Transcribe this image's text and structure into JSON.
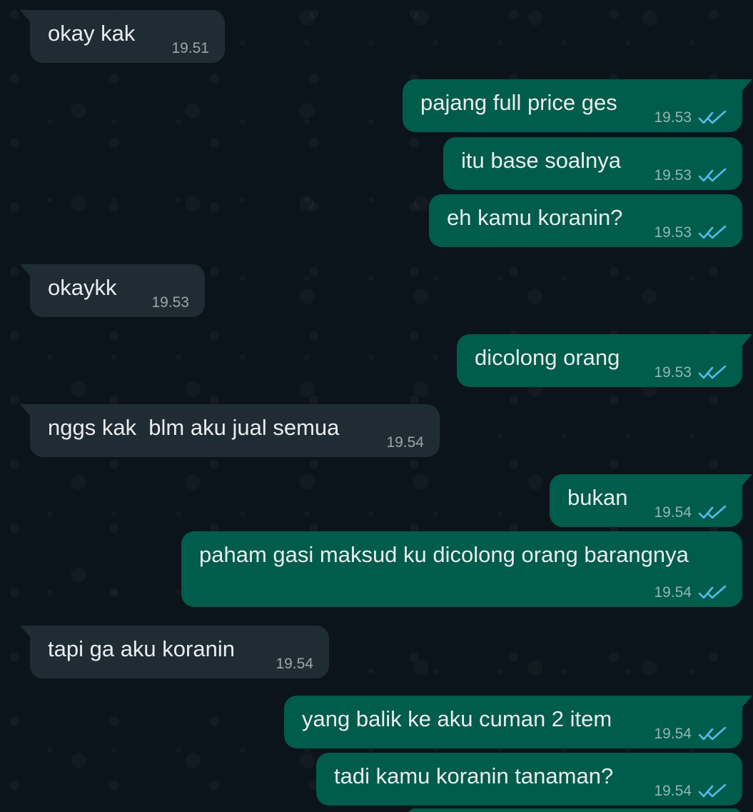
{
  "colors": {
    "background": "#0b141a",
    "incoming_bubble": "#202c33",
    "outgoing_bubble": "#005c4b",
    "text": "#e9edef",
    "read_ticks": "#53bdeb"
  },
  "messages": [
    {
      "direction": "incoming",
      "text": "okay kak",
      "time": "19.51"
    },
    {
      "direction": "outgoing",
      "text": "pajang full price ges",
      "time": "19.53",
      "status": "read-double-check-icon"
    },
    {
      "direction": "outgoing",
      "text": "itu base soalnya",
      "time": "19.53",
      "status": "read-double-check-icon"
    },
    {
      "direction": "outgoing",
      "text": "eh kamu koranin?",
      "time": "19.53",
      "status": "read-double-check-icon"
    },
    {
      "direction": "incoming",
      "text": "okaykk",
      "time": "19.53"
    },
    {
      "direction": "outgoing",
      "text": "dicolong orang",
      "time": "19.53",
      "status": "read-double-check-icon"
    },
    {
      "direction": "incoming",
      "text": "nggs kak  blm aku jual semua",
      "time": "19.54"
    },
    {
      "direction": "outgoing",
      "text": "bukan",
      "time": "19.54",
      "status": "read-double-check-icon"
    },
    {
      "direction": "outgoing",
      "text": "paham gasi maksud ku dicolong orang barangnya",
      "time": "19.54",
      "status": "read-double-check-icon"
    },
    {
      "direction": "incoming",
      "text": "tapi ga aku koranin",
      "time": "19.54"
    },
    {
      "direction": "outgoing",
      "text": "yang balik ke aku cuman 2 item",
      "time": "19.54",
      "status": "read-double-check-icon"
    },
    {
      "direction": "outgoing",
      "text": "tadi kamu koranin tanaman?",
      "time": "19.54",
      "status": "read-double-check-icon"
    }
  ]
}
